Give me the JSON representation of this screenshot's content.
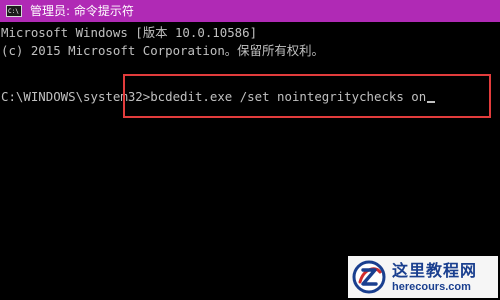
{
  "window": {
    "title": "管理员: 命令提示符",
    "icon": "cmd-icon",
    "titlebar_color": "#b02ab5"
  },
  "console": {
    "line1": "Microsoft Windows [版本 10.0.10586]",
    "line2": "(c) 2015 Microsoft Corporation。保留所有权利。",
    "prompt": "C:\\WINDOWS\\system32>",
    "command": "bcdedit.exe /set nointegritychecks on"
  },
  "annotation": {
    "color": "#e23c3c"
  },
  "watermark": {
    "name": "这里教程网",
    "url": "herecours.com",
    "color": "#1a3f8f"
  }
}
